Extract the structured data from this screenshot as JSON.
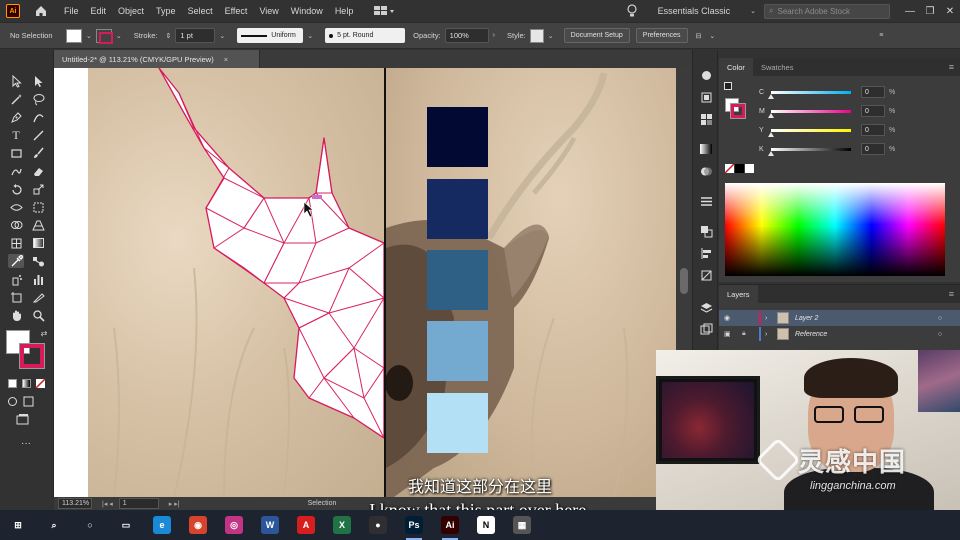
{
  "app": {
    "logo": "Ai"
  },
  "menu": [
    "File",
    "Edit",
    "Object",
    "Type",
    "Select",
    "Effect",
    "View",
    "Window",
    "Help"
  ],
  "workspace": "Essentials Classic",
  "stock_search_placeholder": "Search Adobe Stock",
  "control_bar": {
    "selection": "No Selection",
    "stroke_label": "Stroke:",
    "stroke_weight": "1 pt",
    "profile": "Uniform",
    "brush": "5 pt. Round",
    "opacity_label": "Opacity:",
    "opacity_value": "100%",
    "style_label": "Style:",
    "document_setup": "Document Setup",
    "preferences": "Preferences"
  },
  "document": {
    "tab_title": "Untitled-2* @ 113.21% (CMYK/GPU Preview)",
    "tab_close": "×",
    "zoom": "113.21%",
    "artboard": "1",
    "mode": "Selection"
  },
  "palette_colors": [
    "#020a33",
    "#142a60",
    "#2e5f85",
    "#74a9d0",
    "#b3e0f5"
  ],
  "accent_color": "#d61a5b",
  "color_panel": {
    "tabs": [
      "Color",
      "Swatches"
    ],
    "channels": [
      {
        "label": "C",
        "value": "0",
        "unit": "%",
        "gradient": "linear-gradient(to right,#fff,#00aeef)"
      },
      {
        "label": "M",
        "value": "0",
        "unit": "%",
        "gradient": "linear-gradient(to right,#fff,#ec008c)"
      },
      {
        "label": "Y",
        "value": "0",
        "unit": "%",
        "gradient": "linear-gradient(to right,#fff,#fff200)"
      },
      {
        "label": "K",
        "value": "0",
        "unit": "%",
        "gradient": "linear-gradient(to right,#fff,#000)"
      }
    ]
  },
  "layers_panel": {
    "title": "Layers",
    "layers": [
      {
        "name": "Layer 2",
        "color": "#d61a5b",
        "selected": true,
        "locked": false
      },
      {
        "name": "Reference",
        "color": "#4a7bd6",
        "selected": false,
        "locked": true
      }
    ]
  },
  "subtitles": {
    "cn": "我知道这部分在这里",
    "en": "I know that this part over here,"
  },
  "watermark": {
    "cn": "灵感中国",
    "en": "lingganchina.com"
  },
  "taskbar": [
    {
      "name": "windows-start-icon",
      "label": "⊞",
      "color": "transparent",
      "active": false
    },
    {
      "name": "search-icon",
      "label": "⌕",
      "color": "transparent",
      "active": false
    },
    {
      "name": "cortana-icon",
      "label": "○",
      "color": "transparent",
      "active": false
    },
    {
      "name": "task-view-icon",
      "label": "▭",
      "color": "transparent",
      "active": false
    },
    {
      "name": "edge-icon",
      "label": "e",
      "color": "#1b8ad6",
      "active": false
    },
    {
      "name": "chrome-icon",
      "label": "◉",
      "color": "#d8432d",
      "active": false
    },
    {
      "name": "instagram-icon",
      "label": "◎",
      "color": "#c13584",
      "active": false
    },
    {
      "name": "word-icon",
      "label": "W",
      "color": "#2b579a",
      "active": false
    },
    {
      "name": "acrobat-icon",
      "label": "A",
      "color": "#d71e1e",
      "active": false
    },
    {
      "name": "excel-icon",
      "label": "X",
      "color": "#217346",
      "active": false
    },
    {
      "name": "obs-icon",
      "label": "●",
      "color": "#302e31",
      "active": false
    },
    {
      "name": "photoshop-icon",
      "label": "Ps",
      "color": "#001e36",
      "active": true
    },
    {
      "name": "illustrator-icon",
      "label": "Ai",
      "color": "#330000",
      "active": true
    },
    {
      "name": "notion-icon",
      "label": "N",
      "color": "#ffffff",
      "active": false
    },
    {
      "name": "calculator-icon",
      "label": "▦",
      "color": "#555555",
      "active": false
    }
  ]
}
